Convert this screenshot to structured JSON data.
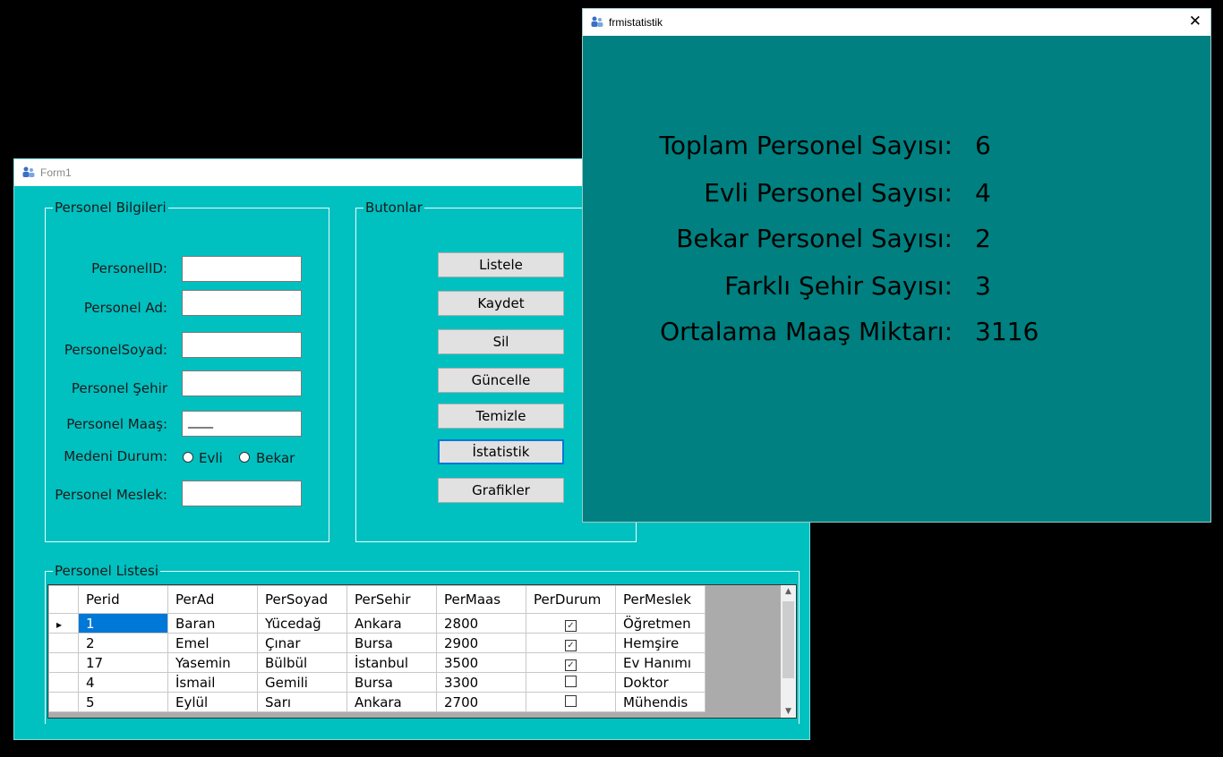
{
  "form1": {
    "title": "Form1",
    "personel_group": {
      "title": "Personel Bilgileri",
      "labels": {
        "id": "PersonelID:",
        "ad": "Personel Ad:",
        "soyad": "PersonelSoyad:",
        "sehir": "Personel Şehir",
        "maas": "Personel Maaş:",
        "medeni": "Medeni Durum:",
        "meslek": "Personel Meslek:"
      },
      "maas_value": "____",
      "radio_evli": "Evli",
      "radio_bekar": "Bekar"
    },
    "buttons_group": {
      "title": "Butonlar",
      "listele": "Listele",
      "kaydet": "Kaydet",
      "sil": "Sil",
      "guncelle": "Güncelle",
      "temizle": "Temizle",
      "istatistik": "İstatistik",
      "grafikler": "Grafikler"
    },
    "list_group": {
      "title": "Personel Listesi",
      "columns": [
        "Perid",
        "PerAd",
        "PerSoyad",
        "PerSehir",
        "PerMaas",
        "PerDurum",
        "PerMeslek"
      ],
      "rows": [
        {
          "id": "1",
          "ad": "Baran",
          "soyad": "Yücedağ",
          "sehir": "Ankara",
          "maas": "2800",
          "durum": true,
          "meslek": "Öğretmen"
        },
        {
          "id": "2",
          "ad": "Emel",
          "soyad": "Çınar",
          "sehir": "Bursa",
          "maas": "2900",
          "durum": true,
          "meslek": "Hemşire"
        },
        {
          "id": "17",
          "ad": "Yasemin",
          "soyad": "Bülbül",
          "sehir": "İstanbul",
          "maas": "3500",
          "durum": true,
          "meslek": "Ev Hanımı"
        },
        {
          "id": "4",
          "ad": "İsmail",
          "soyad": "Gemili",
          "sehir": "Bursa",
          "maas": "3300",
          "durum": false,
          "meslek": "Doktor"
        },
        {
          "id": "5",
          "ad": "Eylül",
          "soyad": "Sarı",
          "sehir": "Ankara",
          "maas": "2700",
          "durum": false,
          "meslek": "Mühendis"
        }
      ]
    }
  },
  "frm": {
    "title": "frmistatistik",
    "close_glyph": "✕",
    "stats": [
      {
        "label": "Toplam Personel Sayısı:",
        "value": "6"
      },
      {
        "label": "Evli Personel Sayısı:",
        "value": "4"
      },
      {
        "label": "Bekar Personel Sayısı:",
        "value": "2"
      },
      {
        "label": "Farklı Şehir Sayısı:",
        "value": "3"
      },
      {
        "label": "Ortalama Maaş Miktarı:",
        "value": "3116"
      }
    ]
  },
  "colors": {
    "form_bg": "#00c0c0",
    "stats_bg": "#008080",
    "selection": "#0078d7"
  },
  "icons": [
    "app-users-icon",
    "close-icon",
    "row-pointer-icon",
    "checkbox-checked-icon",
    "scroll-up-icon",
    "scroll-down-icon"
  ]
}
